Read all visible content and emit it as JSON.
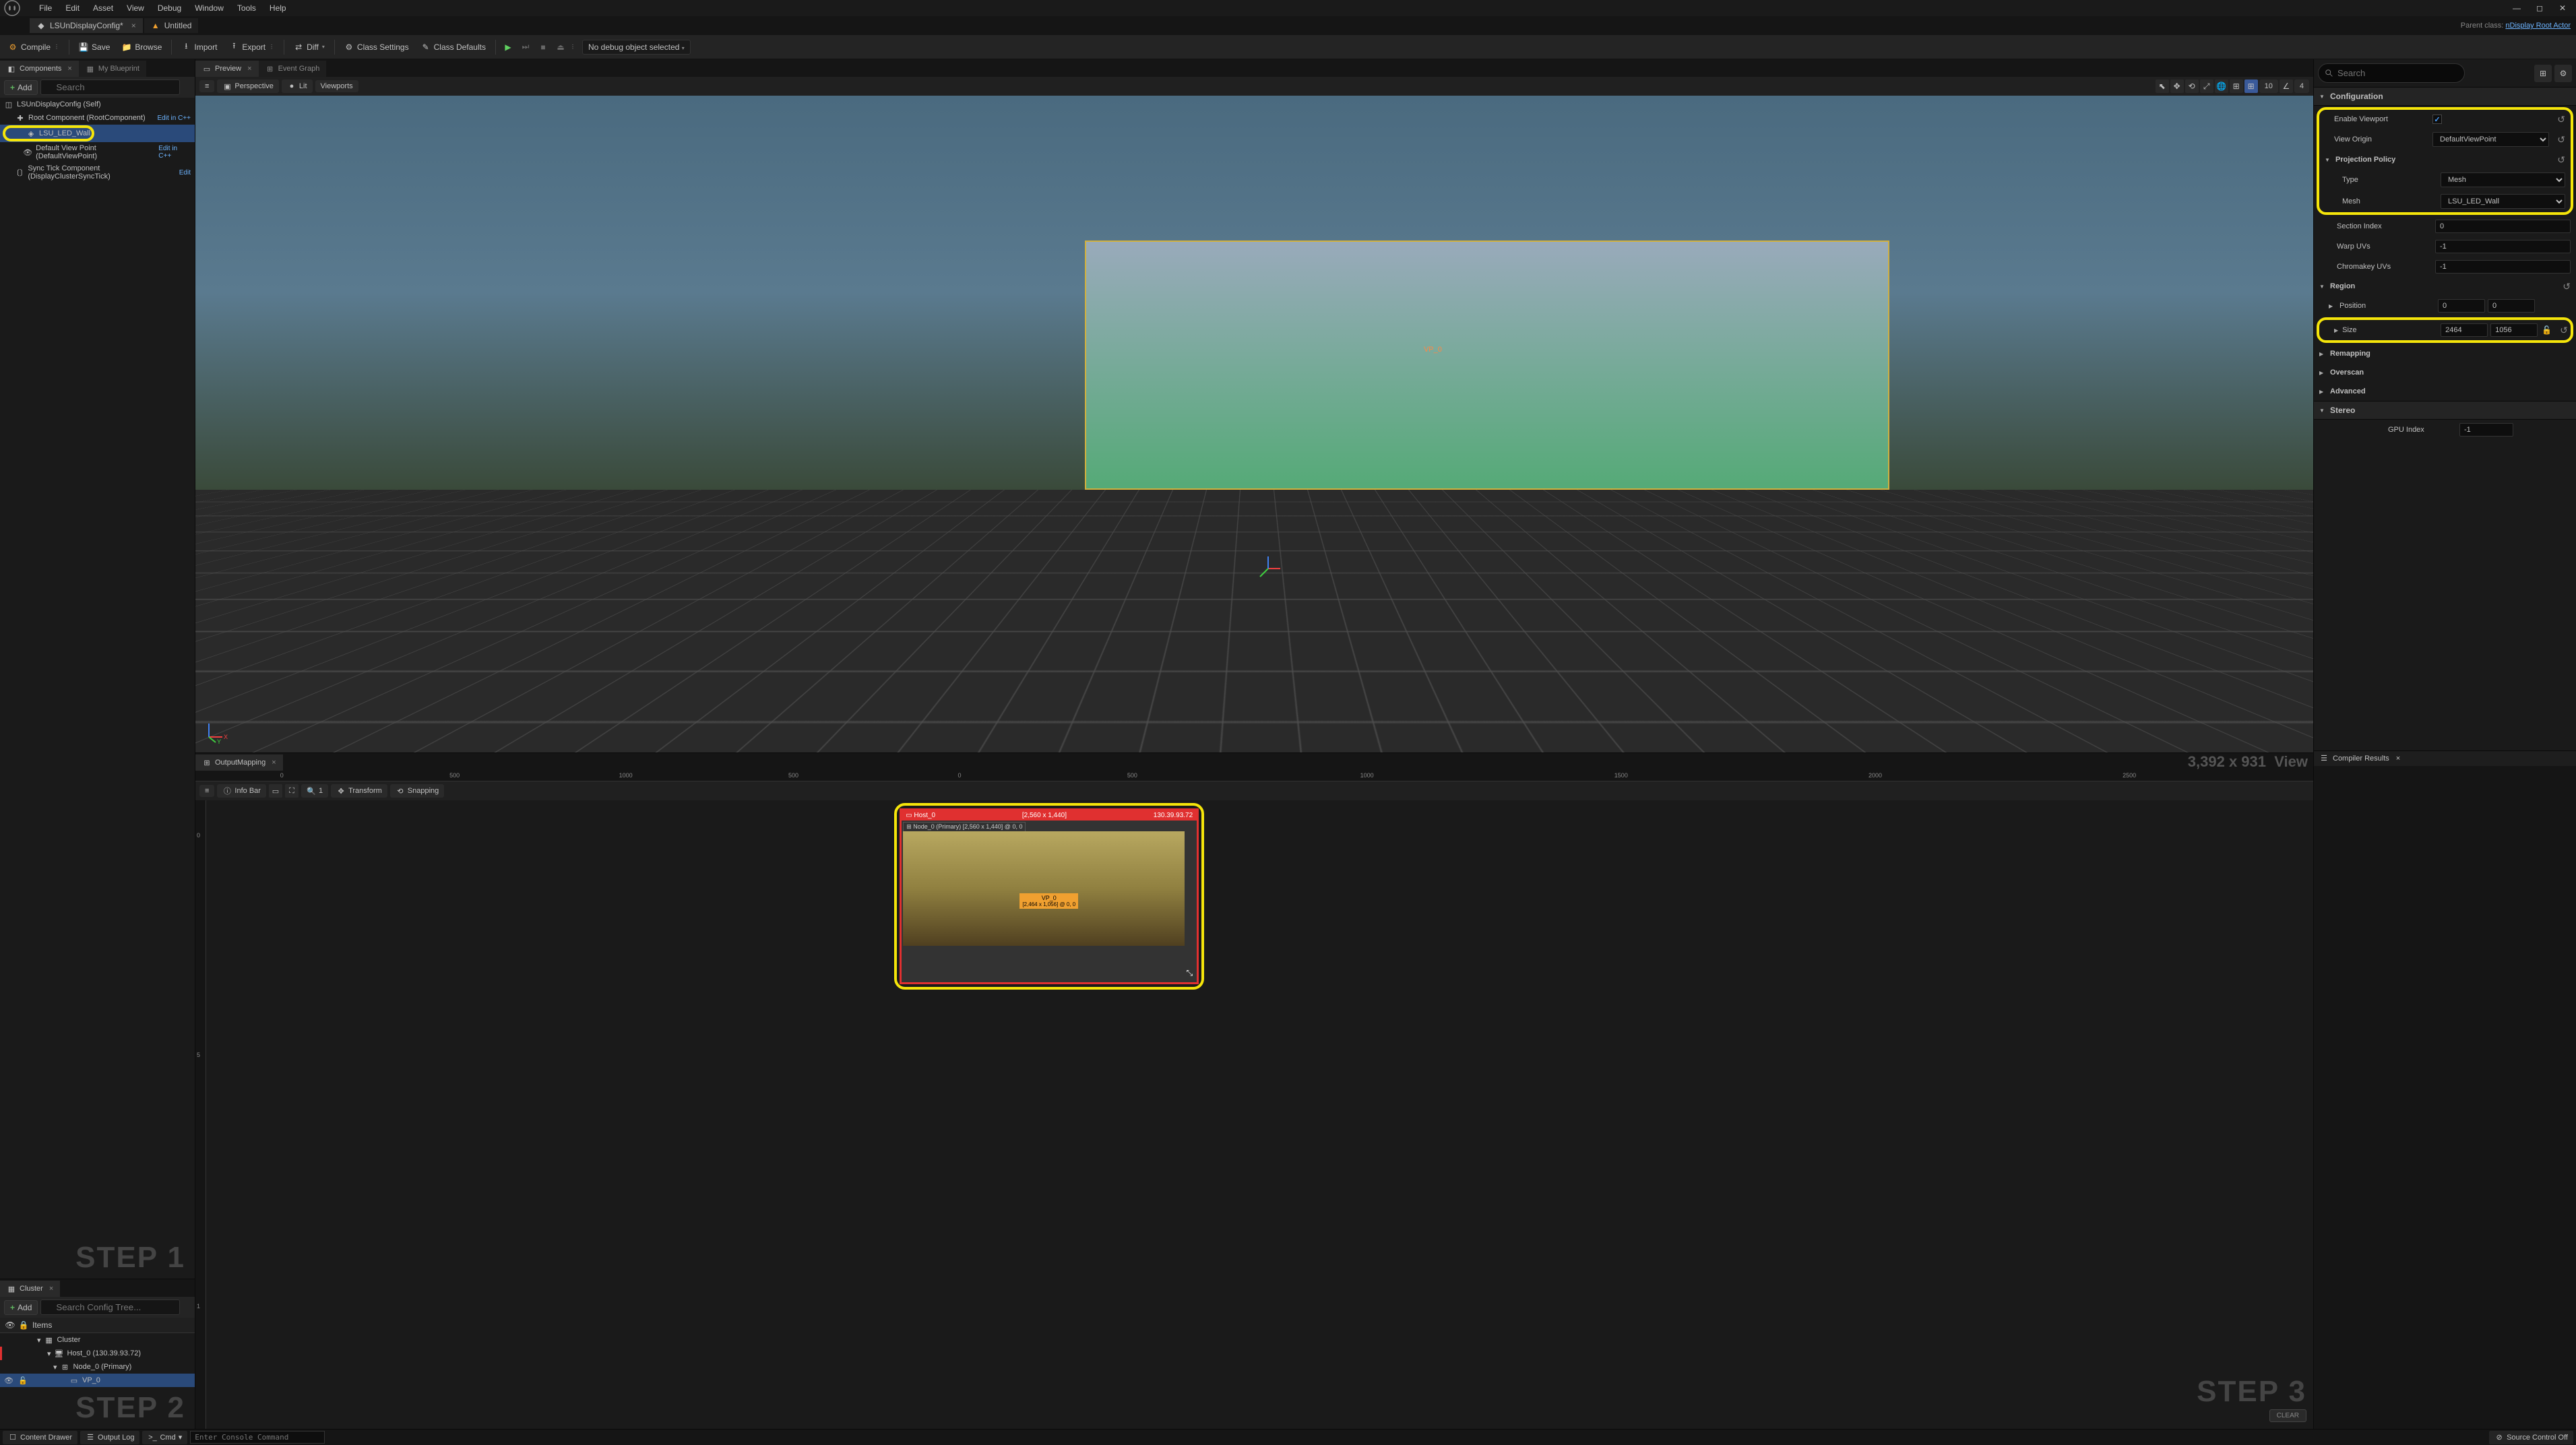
{
  "menubar": {
    "items": [
      "File",
      "Edit",
      "Asset",
      "View",
      "Debug",
      "Window",
      "Tools",
      "Help"
    ]
  },
  "tabs": [
    {
      "label": "LSUnDisplayConfig*",
      "active": true
    },
    {
      "label": "Untitled",
      "active": false
    }
  ],
  "parent_class": {
    "prefix": "Parent class:",
    "name": "nDisplay Root Actor"
  },
  "toolbar": {
    "compile": "Compile",
    "save": "Save",
    "browse": "Browse",
    "import": "Import",
    "export": "Export",
    "diff": "Diff",
    "class_settings": "Class Settings",
    "class_defaults": "Class Defaults",
    "debug_select": "No debug object selected"
  },
  "left_tabs": {
    "components": "Components",
    "my_blueprint": "My Blueprint"
  },
  "add_btn": "Add",
  "search_placeholder": "Search",
  "components_tree": [
    {
      "name": "LSUnDisplayConfig (Self)",
      "icon": "cube",
      "indent": 0
    },
    {
      "name": "Root Component (RootComponent)",
      "icon": "axis",
      "indent": 1,
      "edit": "Edit in C++"
    },
    {
      "name": "LSU_LED_Wall",
      "icon": "mesh",
      "indent": 2,
      "highlighted": true
    },
    {
      "name": "Default View Point (DefaultViewPoint)",
      "icon": "eye",
      "indent": 2,
      "edit": "Edit in C++"
    },
    {
      "name": "Sync Tick Component (DisplayClusterSyncTick)",
      "icon": "brackets",
      "indent": 1,
      "edit": "Edit"
    }
  ],
  "step1": "STEP 1",
  "step2": "STEP 2",
  "step3": "STEP 3",
  "cluster_tab": "Cluster",
  "cluster_search_placeholder": "Search Config Tree...",
  "cluster_items_header": "Items",
  "cluster_tree": [
    {
      "name": "Cluster",
      "indent": 0
    },
    {
      "name": "Host_0 (130.39.93.72)",
      "indent": 1
    },
    {
      "name": "Node_0 (Primary)",
      "indent": 2
    },
    {
      "name": "VP_0",
      "indent": 3,
      "selected": true
    }
  ],
  "center_tabs": {
    "preview": "Preview",
    "event_graph": "Event Graph"
  },
  "viewport_toolbar": {
    "perspective": "Perspective",
    "lit": "Lit",
    "viewports": "Viewports",
    "grid_value": "10",
    "far_value": "4"
  },
  "viewport_label": "VP_0",
  "output_tab": "OutputMapping",
  "output_toolbar": {
    "info_bar": "Info Bar",
    "transform": "Transform",
    "snapping": "Snapping",
    "zoom_value": "1"
  },
  "output_ruler": [
    "0",
    "500",
    "1000",
    "500",
    "0",
    "500",
    "1000",
    "1500",
    "2000",
    "2500"
  ],
  "output_resolution": "3,392 x 931",
  "output_view_lbl": "View",
  "output_host": {
    "name": "Host_0",
    "res": "[2,560 x 1,440]",
    "ip": "130.39.93.72",
    "node_label": "Node_0 (Primary) [2,560 x 1,440] @ 0, 0",
    "vp_name": "VP_0",
    "vp_detail": "[2,464 x 1,056] @ 0, 0"
  },
  "right_search_placeholder": "Search",
  "details": {
    "configuration_hdr": "Configuration",
    "enable_viewport": "Enable Viewport",
    "view_origin": "View Origin",
    "view_origin_value": "DefaultViewPoint",
    "projection_policy": "Projection Policy",
    "type": "Type",
    "type_value": "Mesh",
    "mesh": "Mesh",
    "mesh_value": "LSU_LED_Wall",
    "section_index": "Section Index",
    "section_index_value": "0",
    "warp_uvs": "Warp UVs",
    "warp_uvs_value": "-1",
    "chromakey_uvs": "Chromakey UVs",
    "chromakey_uvs_value": "-1",
    "region_hdr": "Region",
    "position": "Position",
    "position_x": "0",
    "position_y": "0",
    "size": "Size",
    "size_x": "2464",
    "size_y": "1056",
    "remapping_hdr": "Remapping",
    "overscan_hdr": "Overscan",
    "advanced_hdr": "Advanced",
    "stereo_hdr": "Stereo",
    "gpu_index": "GPU Index",
    "gpu_index_value": "-1"
  },
  "compiler_results": "Compiler Results",
  "clear_btn": "CLEAR",
  "statusbar": {
    "content_drawer": "Content Drawer",
    "output_log": "Output Log",
    "cmd": "Cmd",
    "console_placeholder": "Enter Console Command",
    "source_control": "Source Control Off"
  }
}
